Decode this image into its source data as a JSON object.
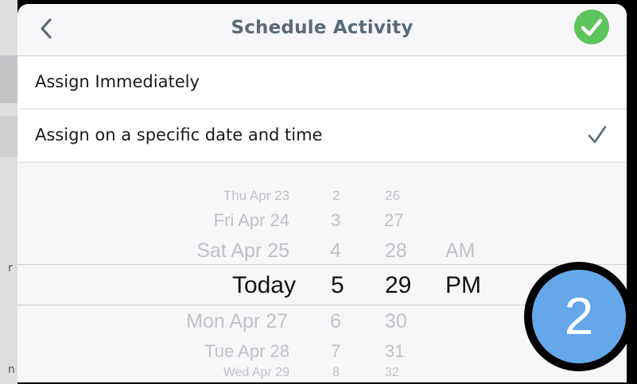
{
  "header": {
    "title": "Schedule Activity",
    "back_icon": "chevron-left-icon",
    "confirm_icon": "checkmark-circle-icon",
    "confirm_color": "#5cc45a"
  },
  "options": [
    {
      "label": "Assign Immediately",
      "selected": false
    },
    {
      "label": "Assign on a specific date and time",
      "selected": true
    }
  ],
  "picker": {
    "days": [
      "Thu Apr 23",
      "Fri Apr 24",
      "Sat Apr 25",
      "Today",
      "Mon Apr 27",
      "Tue Apr 28",
      "Wed Apr 29"
    ],
    "hours": [
      "2",
      "3",
      "4",
      "5",
      "6",
      "7",
      "8"
    ],
    "minutes": [
      "26",
      "27",
      "28",
      "29",
      "30",
      "31",
      "32"
    ],
    "ampm": [
      "AM",
      "PM"
    ],
    "selected": {
      "day": "Today",
      "hour": "5",
      "minute": "29",
      "ampm": "PM"
    }
  },
  "badge": {
    "number": "2",
    "color": "#64a8ea"
  },
  "edge_chars": {
    "left_mid": "r",
    "left_bottom": "n"
  }
}
